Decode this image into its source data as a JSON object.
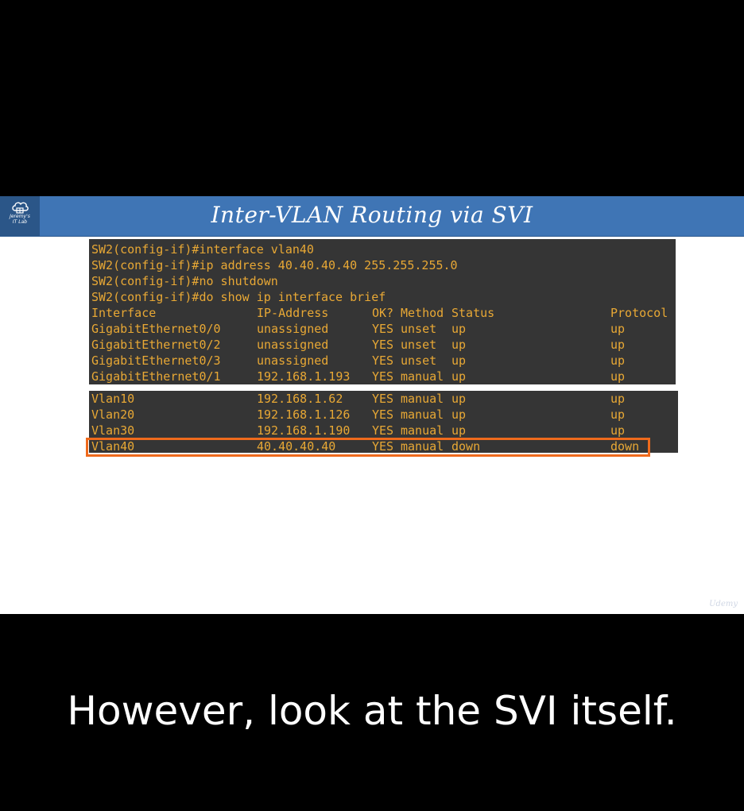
{
  "slide": {
    "title": "Inter-VLAN Routing via SVI",
    "logo": {
      "icon": "cloud-lab-icon",
      "line1": "Jeremy's",
      "line2": "IT Lab"
    },
    "watermark": "Udemy",
    "accent_color": "#3f75b5",
    "terminal_text_color": "#e8a835",
    "highlight_color": "#ef6a1c"
  },
  "terminal": {
    "commands": [
      "SW2(config-if)#interface vlan40",
      "SW2(config-if)#ip address 40.40.40.40 255.255.255.0",
      "SW2(config-if)#no shutdown",
      "SW2(config-if)#do show ip interface brief"
    ],
    "headers": {
      "interface": "Interface",
      "ip": "IP-Address",
      "ok": "OK?",
      "method": "Method",
      "status": "Status",
      "protocol": "Protocol"
    },
    "physical_rows": [
      {
        "interface": "GigabitEthernet0/0",
        "ip": "unassigned",
        "ok": "YES",
        "method": "unset",
        "status": "up",
        "protocol": "up"
      },
      {
        "interface": "GigabitEthernet0/2",
        "ip": "unassigned",
        "ok": "YES",
        "method": "unset",
        "status": "up",
        "protocol": "up"
      },
      {
        "interface": "GigabitEthernet0/3",
        "ip": "unassigned",
        "ok": "YES",
        "method": "unset",
        "status": "up",
        "protocol": "up"
      },
      {
        "interface": "GigabitEthernet0/1",
        "ip": "192.168.1.193",
        "ok": "YES",
        "method": "manual",
        "status": "up",
        "protocol": "up"
      }
    ],
    "vlan_rows": [
      {
        "interface": "Vlan10",
        "ip": "192.168.1.62",
        "ok": "YES",
        "method": "manual",
        "status": "up",
        "protocol": "up"
      },
      {
        "interface": "Vlan20",
        "ip": "192.168.1.126",
        "ok": "YES",
        "method": "manual",
        "status": "up",
        "protocol": "up"
      },
      {
        "interface": "Vlan30",
        "ip": "192.168.1.190",
        "ok": "YES",
        "method": "manual",
        "status": "up",
        "protocol": "up"
      },
      {
        "interface": "Vlan40",
        "ip": "40.40.40.40",
        "ok": "YES",
        "method": "manual",
        "status": "down",
        "protocol": "down"
      }
    ]
  },
  "caption": "However, look at the SVI itself."
}
